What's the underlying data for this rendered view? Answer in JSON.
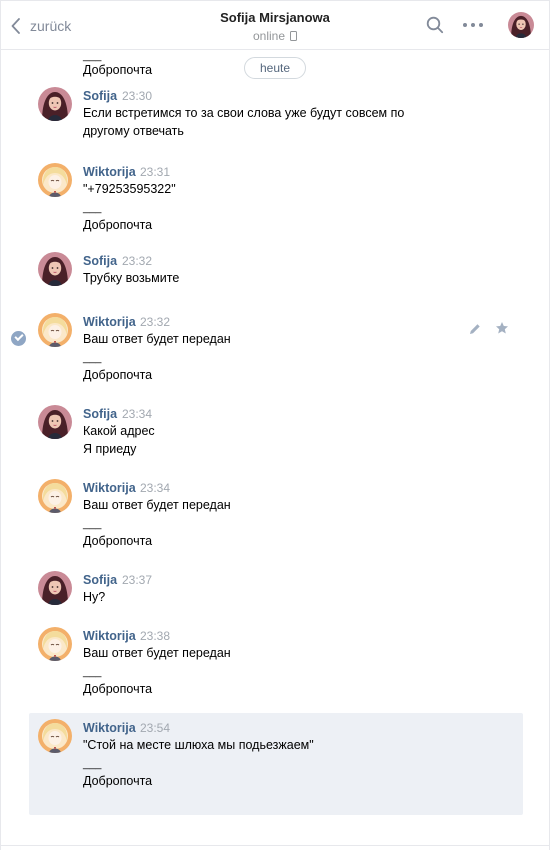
{
  "header": {
    "back_label": "zurück",
    "peer_name": "Sofija Mirsjanowa",
    "peer_status": "online"
  },
  "date_divider": "heute",
  "top_partial": {
    "separator": "___",
    "signature": "Добропочта"
  },
  "messages": [
    {
      "author": "Sofija",
      "time": "23:30",
      "lines": [
        "Если встретимся то за свои слова уже будут совсем по",
        "другому отвечать"
      ]
    },
    {
      "author": "Wiktorija",
      "time": "23:31",
      "lines": [
        "\"+79253595322\""
      ],
      "separator": "___",
      "signature": "Добропочта"
    },
    {
      "author": "Sofija",
      "time": "23:32",
      "lines": [
        "Трубку возьмите"
      ]
    },
    {
      "author": "Wiktorija",
      "time": "23:32",
      "lines": [
        "Ваш ответ будет передан"
      ],
      "separator": "___",
      "signature": "Добропочта"
    },
    {
      "author": "Sofija",
      "time": "23:34",
      "lines": [
        "Какой адрес",
        "Я приеду"
      ]
    },
    {
      "author": "Wiktorija",
      "time": "23:34",
      "lines": [
        "Ваш ответ будет передан"
      ],
      "separator": "___",
      "signature": "Добропочта"
    },
    {
      "author": "Sofija",
      "time": "23:37",
      "lines": [
        "Ну?"
      ]
    },
    {
      "author": "Wiktorija",
      "time": "23:38",
      "lines": [
        "Ваш ответ будет передан"
      ],
      "separator": "___",
      "signature": "Добропочта"
    },
    {
      "author": "Wiktorija",
      "time": "23:54",
      "lines": [
        "\"Стой на месте шлюха мы подьезжаем\""
      ],
      "separator": "___",
      "signature": "Добропочта"
    }
  ],
  "icons": {
    "back": "chevron-left-icon",
    "search": "search-icon",
    "more": "more-dots-icon",
    "edit": "pencil-icon",
    "favorite": "star-icon",
    "selected": "check-icon"
  },
  "colors": {
    "author": "#42648b",
    "time": "#a2a8b0",
    "selected_background": "#edf0f5",
    "header_border": "#e7e8ec"
  }
}
